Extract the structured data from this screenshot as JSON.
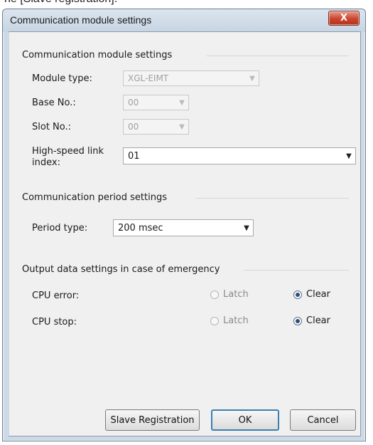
{
  "caption_fragment": "he [Slave registration].",
  "window": {
    "title": "Communication module settings",
    "close_glyph": "X"
  },
  "module_group": {
    "title": "Communication module settings",
    "module_type_label": "Module type:",
    "module_type_value": "XGL-EIMT",
    "base_no_label": "Base No.:",
    "base_no_value": "00",
    "slot_no_label": "Slot No.:",
    "slot_no_value": "00",
    "hs_link_label_line1": "High-speed link",
    "hs_link_label_line2": "index:",
    "hs_link_value": "01"
  },
  "period_group": {
    "title": "Communication period settings",
    "period_type_label": "Period type:",
    "period_type_value": "200 msec"
  },
  "emergency_group": {
    "title": "Output data settings in case of emergency",
    "rows": [
      {
        "label": "CPU error:",
        "latch": "Latch",
        "clear": "Clear",
        "selected": "clear"
      },
      {
        "label": "CPU stop:",
        "latch": "Latch",
        "clear": "Clear",
        "selected": "clear"
      }
    ]
  },
  "buttons": {
    "slave_registration": "Slave Registration",
    "ok": "OK",
    "cancel": "Cancel"
  },
  "icons": {
    "dropdown": "chevron-down-icon",
    "close": "close-icon"
  }
}
